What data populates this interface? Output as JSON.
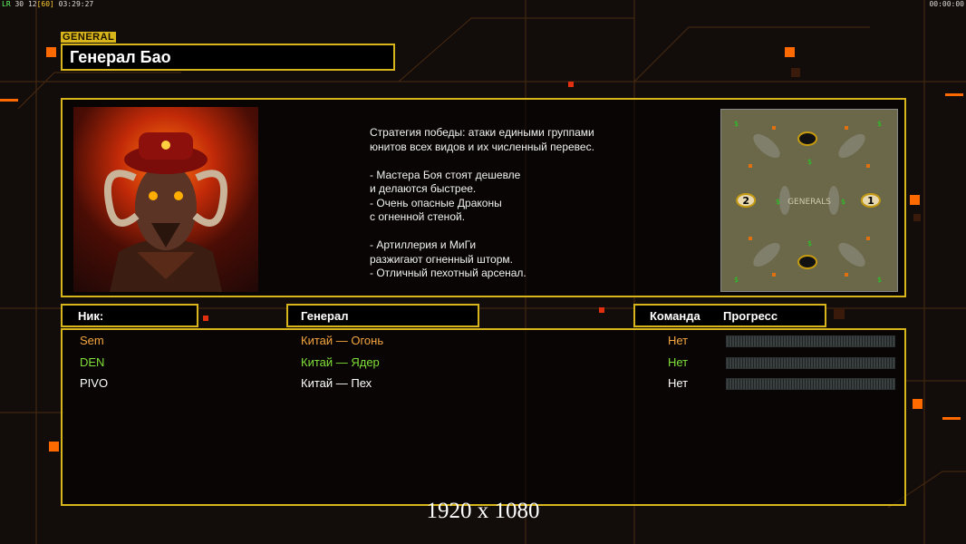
{
  "hud": {
    "left_prefix": "LR",
    "fps": "30",
    "fps2": "12",
    "fps3": "[60]",
    "clock": "03:29:27",
    "right_time": "00:00:00"
  },
  "section_tag": "GENERAL",
  "general_name": "Генерал Бао",
  "description": "Стратегия победы: атаки едиными группами\nюнитов всех видов и их численный перевес.\n\n- Мастера Боя стоят дешевле\nи делаются быстрее.\n- Очень опасные Драконы\nс огненной стеной.\n\n- Артиллерия и МиГи\nразжигают огненный шторм.\n- Отличный пехотный арсенал.",
  "portrait_icon": "horned-general-portrait",
  "minimap": {
    "icon": "map-preview",
    "logo_text": "GENERALS",
    "markers": [
      {
        "label": "2",
        "nx": 0.14,
        "ny": 0.5
      },
      {
        "label": "1",
        "nx": 0.85,
        "ny": 0.5
      },
      {
        "label": "",
        "nx": 0.49,
        "ny": 0.16
      },
      {
        "label": "",
        "nx": 0.49,
        "ny": 0.84
      }
    ]
  },
  "headers": {
    "nick": "Ник:",
    "general": "Генерал",
    "team": "Команда",
    "progress": "Прогресс"
  },
  "players": [
    {
      "nick": "Sem",
      "general": "Китай — Огонь",
      "team": "Нет",
      "color": "#f5a640",
      "progress": 0
    },
    {
      "nick": "DEN",
      "general": "Китай — Ядер",
      "team": "Нет",
      "color": "#7fe03a",
      "progress": 0
    },
    {
      "nick": "PIVO",
      "general": "Китай — Пех",
      "team": "Нет",
      "color": "#ffffff",
      "progress": 0
    }
  ],
  "resolution_label": "1920 x 1080",
  "colors": {
    "frame": "#d8b51a",
    "accent": "#ff6a00"
  }
}
